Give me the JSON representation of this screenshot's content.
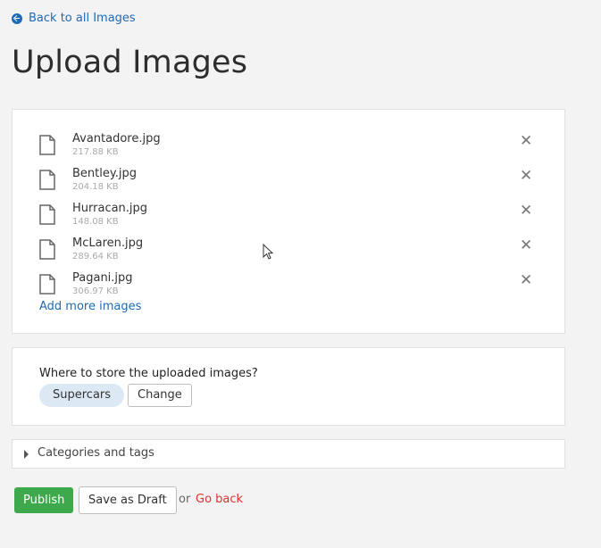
{
  "nav": {
    "back_label": "Back to all Images",
    "back_icon": "arrow-circle-left-icon"
  },
  "page": {
    "title": "Upload Images"
  },
  "files": [
    {
      "name": "Avantadore.jpg",
      "size": "217.88 KB"
    },
    {
      "name": "Bentley.jpg",
      "size": "204.18 KB"
    },
    {
      "name": "Hurracan.jpg",
      "size": "148.08 KB"
    },
    {
      "name": "McLaren.jpg",
      "size": "289.64 KB"
    },
    {
      "name": "Pagani.jpg",
      "size": "306.97 KB"
    }
  ],
  "file_icon": "file-icon",
  "remove_icon": "close-icon",
  "add_more_label": "Add more images",
  "storage": {
    "question": "Where to store the uploaded images?",
    "folder": "Supercars",
    "change_label": "Change"
  },
  "categories": {
    "label": "Categories and tags",
    "expanded": false
  },
  "actions": {
    "publish_label": "Publish",
    "draft_label": "Save as Draft",
    "or_text": "or",
    "go_back_label": "Go back"
  },
  "colors": {
    "link": "#1d6bb5",
    "publish": "#3ea84c",
    "danger": "#d9342b",
    "chip": "#dce9f5",
    "background": "#f3f3f4"
  }
}
